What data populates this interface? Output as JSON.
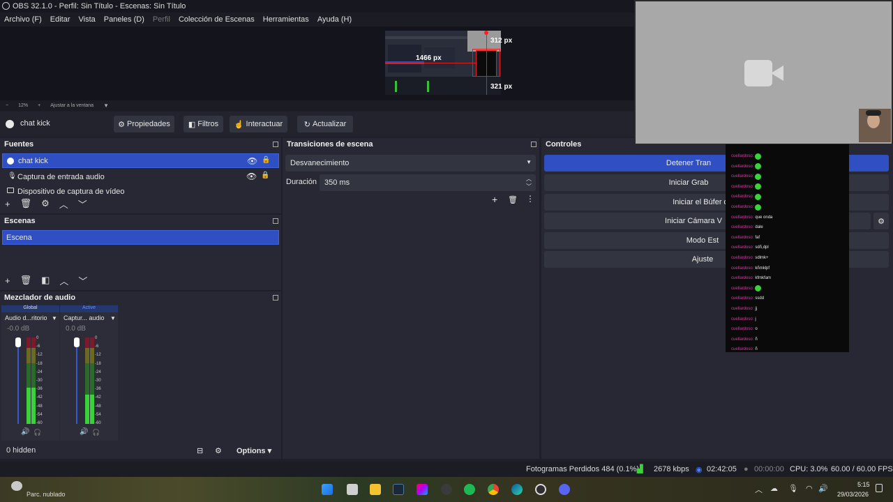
{
  "window": {
    "title": "OBS 32.1.0 - Perfil: Sin Título - Escenas: Sin Título"
  },
  "menu": {
    "items": [
      "Archivo (F)",
      "Editar",
      "Vista",
      "Paneles (D)",
      "Perfil",
      "Colección de Escenas",
      "Herramientas",
      "Ayuda (H)"
    ]
  },
  "preview": {
    "label_width": "1466 px",
    "label_top": "312 px",
    "label_bottom": "321 px"
  },
  "zoom": {
    "minus": "−",
    "value": "12%",
    "plus": "+",
    "fit": "Ajustar a la ventana"
  },
  "context": {
    "source": "chat kick",
    "properties": "Propiedades",
    "filters": "Filtros",
    "interact": "Interactuar",
    "refresh": "Actualizar"
  },
  "sources": {
    "title": "Fuentes",
    "items": [
      {
        "label": "chat kick"
      },
      {
        "label": "Captura de entrada audio"
      },
      {
        "label": "Dispositivo de captura de vídeo"
      }
    ]
  },
  "scenes": {
    "title": "Escenas",
    "items": [
      {
        "label": "Escena"
      }
    ]
  },
  "transitions": {
    "title": "Transiciones de escena",
    "selected": "Desvanecimiento",
    "duration_label": "Duración",
    "duration_value": "350 ms"
  },
  "controls": {
    "title": "Controles",
    "buttons": [
      "Detener Tran",
      "Iniciar Grab",
      "Iniciar el Búfer de",
      "Iniciar Cámara V",
      "Modo Est",
      "Ajuste"
    ]
  },
  "mixer": {
    "title": "Mezclador de audio",
    "channels": [
      {
        "tag": "Global",
        "name": "Audio d...ritorio",
        "db": "-0.0 dB"
      },
      {
        "tag": "Active",
        "name": "Captur... audio",
        "db": "0.0 dB"
      }
    ],
    "scale": [
      "0",
      "-6",
      "-12",
      "-18",
      "-24",
      "-30",
      "-36",
      "-42",
      "-48",
      "-54",
      "-60"
    ],
    "hidden": "0 hidden",
    "options": "Options"
  },
  "status": {
    "dropped": "Fotogramas Perdidos 484 (0.1%)",
    "bitrate": "2678 kbps",
    "stream_time": "02:42:05",
    "rec_time": "00:00:00",
    "cpu": "CPU: 3.0%",
    "fps": "60.00 / 60.00 FPS"
  },
  "chat": {
    "user": "cuellardoso",
    "messages": [
      "",
      "",
      "",
      "",
      "",
      "",
      "que onda",
      "dale",
      "faf",
      "sdñ,dpl",
      "sdlmk+",
      "kñmklpf",
      "kfmkfam",
      "",
      "ssdd",
      "jj",
      "j",
      "o",
      "ñ",
      "ñ"
    ]
  },
  "taskbar": {
    "weather": "Parc. nublado",
    "time": "5:15",
    "date": "29/03/2026"
  },
  "colors": {
    "accent": "#2f4fc2",
    "bg": "#1e1f29",
    "panel": "#272833"
  }
}
